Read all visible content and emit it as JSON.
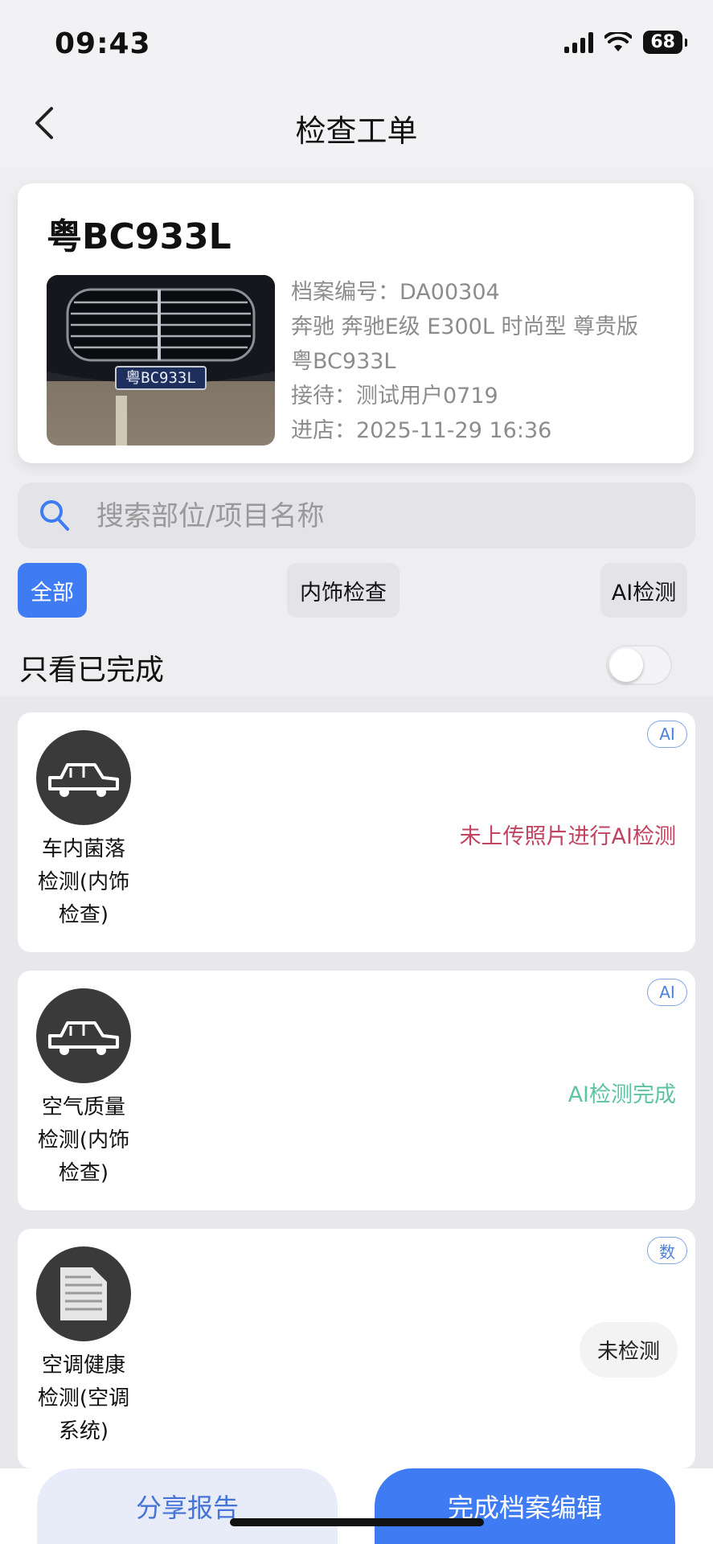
{
  "status_bar": {
    "time": "09:43",
    "battery": "68"
  },
  "nav": {
    "title": "检查工单"
  },
  "vehicle": {
    "plate": "粤BC933L",
    "photo_plate_text": "粤BC933L",
    "info": [
      "档案编号：DA00304",
      "奔驰 奔驰E级 E300L 时尚型 尊贵版",
      "粤BC933L",
      "接待：测试用户0719",
      "进店：2025-11-29 16:36"
    ]
  },
  "search": {
    "placeholder": "搜索部位/项目名称"
  },
  "filters": {
    "all": "全部",
    "interior": "内饰检查",
    "ai": "AI检测"
  },
  "toggle": {
    "label": "只看已完成",
    "on": false
  },
  "items": [
    {
      "name_lines": [
        "车内菌落",
        "检测(内饰",
        "检查)"
      ],
      "badge": "AI",
      "status": "未上传照片进行AI检测",
      "icon": "car-icon",
      "status_color": "#c0435f"
    },
    {
      "name_lines": [
        "空气质量",
        "检测(内饰",
        "检查)"
      ],
      "badge": "AI",
      "status": "AI检测完成",
      "icon": "car-icon",
      "status_color": "#5dc3a3"
    },
    {
      "name_lines": [
        "空调健康",
        "检测(空调",
        "系统)"
      ],
      "badge": "数",
      "status": "未检测",
      "icon": "ac-unit-icon"
    }
  ],
  "bottom": {
    "share": "分享报告",
    "finish": "完成档案编辑"
  }
}
